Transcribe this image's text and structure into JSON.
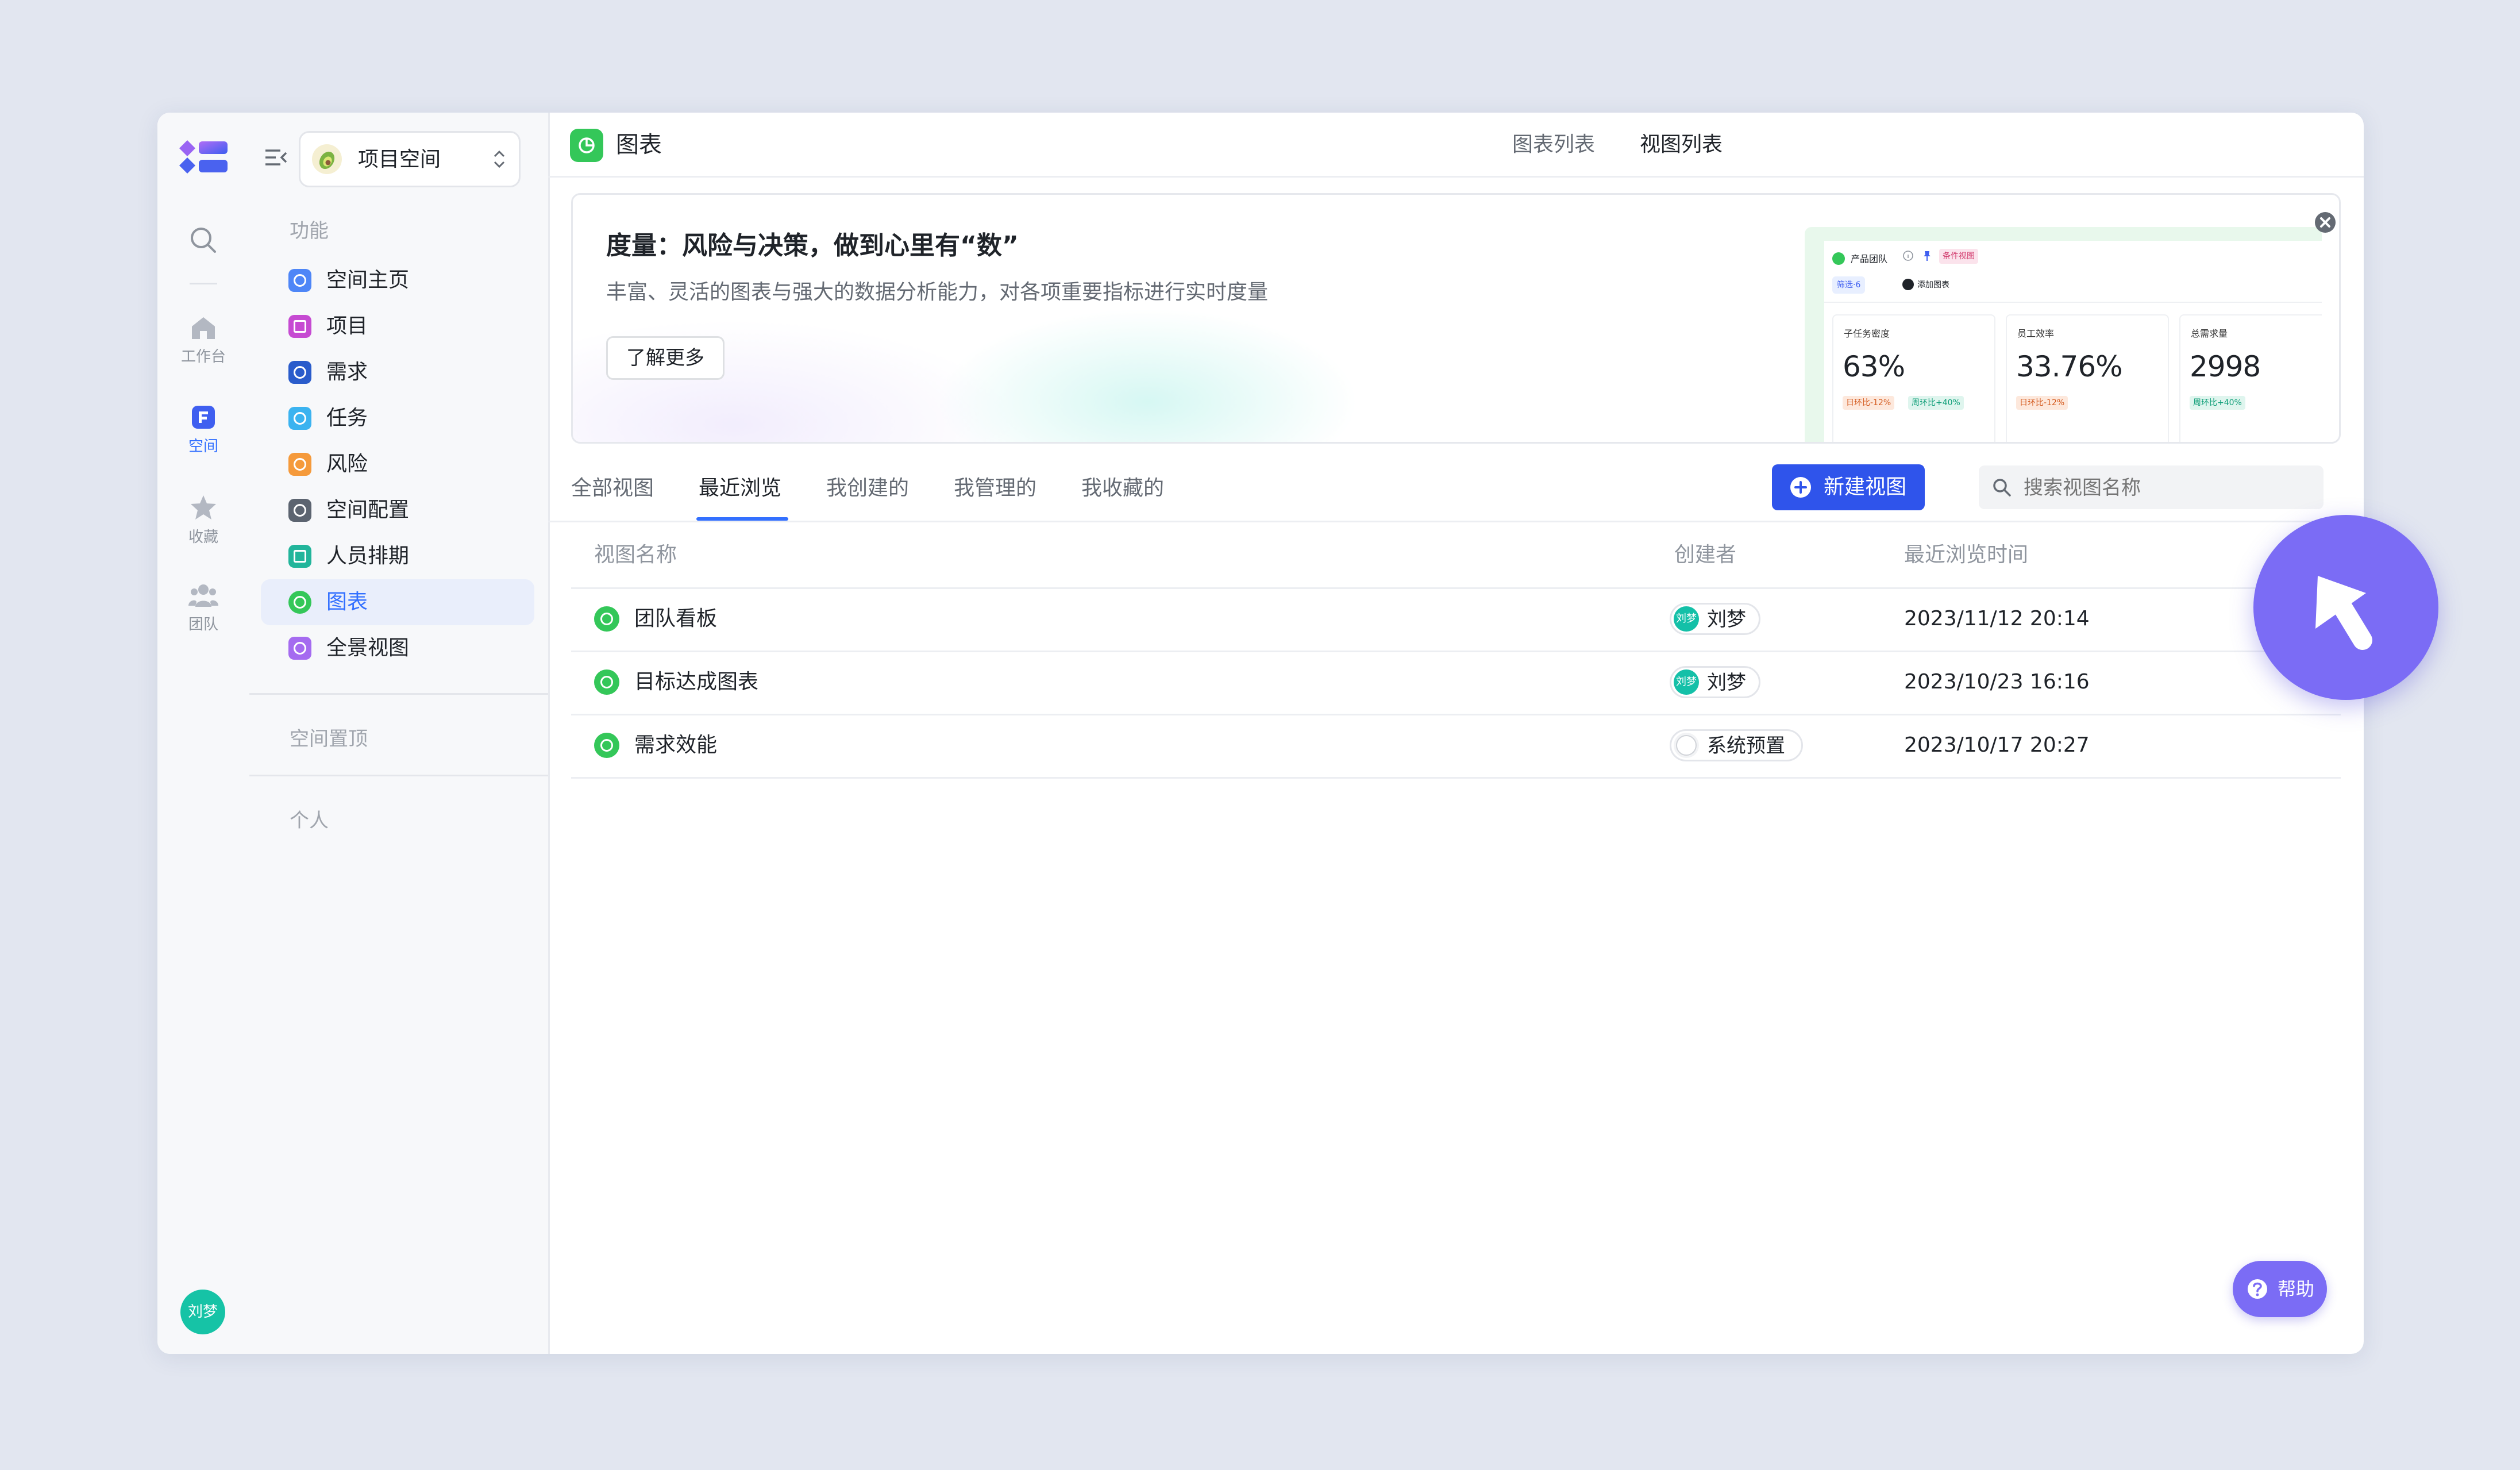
{
  "rail": {
    "avatar_text": "刘梦",
    "items": [
      {
        "label": "工作台",
        "icon": "home-icon"
      },
      {
        "label": "空间",
        "icon": "space-icon"
      },
      {
        "label": "收藏",
        "icon": "star-icon"
      },
      {
        "label": "团队",
        "icon": "team-icon"
      }
    ]
  },
  "sidebar": {
    "space_name": "项目空间",
    "section_features": "功能",
    "items": [
      {
        "label": "空间主页",
        "color": "#4e86f7"
      },
      {
        "label": "项目",
        "color": "#c64bd2"
      },
      {
        "label": "需求",
        "color": "#2a5ccb"
      },
      {
        "label": "任务",
        "color": "#3bb3f0"
      },
      {
        "label": "风险",
        "color": "#f59a3b"
      },
      {
        "label": "空间配置",
        "color": "#5c6470"
      },
      {
        "label": "人员排期",
        "color": "#22b59b"
      },
      {
        "label": "图表",
        "color": "#34c759"
      },
      {
        "label": "全景视图",
        "color": "#a56bf0"
      }
    ],
    "active_item": "图表",
    "section_pinned": "空间置顶",
    "section_personal": "个人"
  },
  "header": {
    "title": "图表",
    "tabs": [
      "图表列表",
      "视图列表"
    ],
    "active_tab": "视图列表"
  },
  "banner": {
    "title": "度量：风险与决策，做到心里有“数”",
    "subtitle": "丰富、灵活的图表与强大的数据分析能力，对各项重要指标进行实时度量",
    "button": "了解更多",
    "preview": {
      "team_label": "产品团队",
      "tag": "条件视图",
      "filter": "筛选·6",
      "add_chart": "添加图表",
      "cards": [
        {
          "label": "子任务密度",
          "value": "63%",
          "badges": [
            "日环比-12%",
            "周环比+40%"
          ]
        },
        {
          "label": "员工效率",
          "value": "33.76%",
          "badges": [
            "日环比-12%"
          ]
        },
        {
          "label": "总需求量",
          "value": "2998",
          "badges": [
            "周环比+40%"
          ]
        }
      ]
    }
  },
  "tabs": {
    "items": [
      "全部视图",
      "最近浏览",
      "我创建的",
      "我管理的",
      "我收藏的"
    ],
    "active": "最近浏览"
  },
  "search": {
    "placeholder": "搜索视图名称"
  },
  "new_view_button": "新建视图",
  "table": {
    "columns": [
      "视图名称",
      "创建者",
      "最近浏览时间"
    ],
    "rows": [
      {
        "name": "团队看板",
        "creator": "刘梦",
        "avatar": "刘梦",
        "time": "2023/11/12 20:14"
      },
      {
        "name": "目标达成图表",
        "creator": "刘梦",
        "avatar": "刘梦",
        "time": "2023/10/23 16:16"
      },
      {
        "name": "需求效能",
        "creator": "系统预置",
        "avatar": "",
        "time": "2023/10/17 20:27"
      }
    ]
  },
  "help_button": "帮助",
  "colors": {
    "accent": "#3370ff",
    "primary_button": "#2f54eb",
    "cursor_circle": "#7b6cf5",
    "help_button": "#7b6cf5"
  }
}
